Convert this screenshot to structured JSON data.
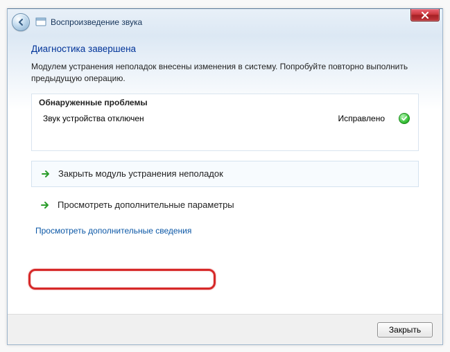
{
  "window": {
    "title": "Воспроизведение звука"
  },
  "heading": "Диагностика завершена",
  "description": "Модулем устранения неполадок внесены изменения в систему. Попробуйте повторно выполнить предыдущую операцию.",
  "problems": {
    "header": "Обнаруженные проблемы",
    "items": [
      {
        "name": "Звук устройства отключен",
        "status": "Исправлено",
        "status_icon": "fixed-check"
      }
    ]
  },
  "actions": {
    "close_troubleshooter": "Закрыть модуль устранения неполадок",
    "explore_options": "Просмотреть дополнительные параметры"
  },
  "details_link": "Просмотреть дополнительные сведения",
  "footer": {
    "close": "Закрыть"
  },
  "icons": {
    "back": "back-arrow-icon",
    "window": "troubleshooter-icon",
    "close": "close-icon",
    "action_arrow": "arrow-right-icon",
    "fixed": "check-icon"
  },
  "colors": {
    "link": "#0B57A6",
    "heading": "#003399",
    "highlight": "#d62828"
  }
}
